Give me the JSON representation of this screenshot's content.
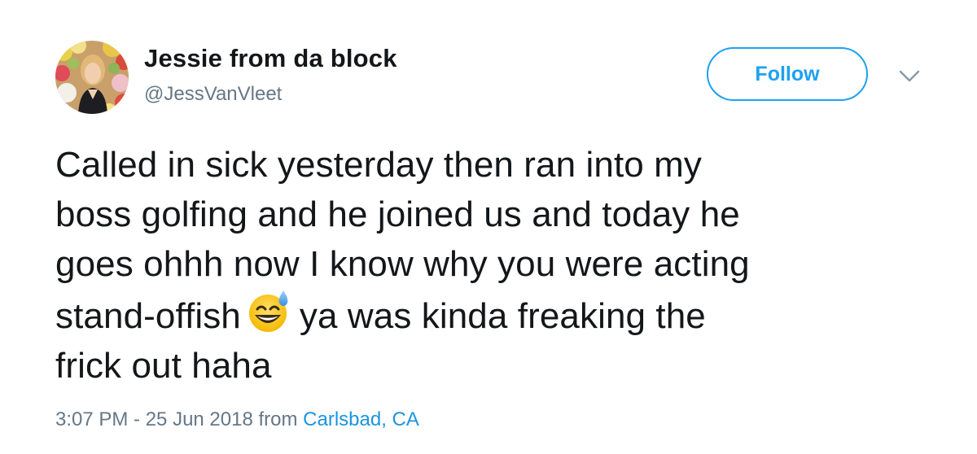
{
  "author": {
    "display_name": "Jessie from da block",
    "handle": "@JessVanVleet"
  },
  "follow_button": {
    "label": "Follow"
  },
  "menu": {
    "icon": "chevron-down-icon"
  },
  "tweet": {
    "lines": [
      "Called in sick yesterday then ran into my",
      "boss golfing and he joined us and today he",
      "goes ohhh now I know why you were acting",
      "stand-offish",
      "ya was kinda freaking the",
      "frick out haha"
    ],
    "emoji": "grinning-face-with-sweat-emoji"
  },
  "meta": {
    "time_date": "3:07 PM - 25 Jun 2018",
    "from_word": "from",
    "location": "Carlsbad, CA"
  },
  "colors": {
    "accent": "#1da1f2",
    "link": "#1b95e0",
    "text": "#14171a",
    "secondary_text": "#657786"
  }
}
